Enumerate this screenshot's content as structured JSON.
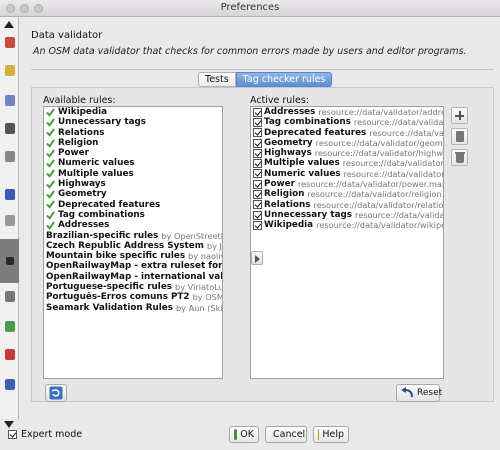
{
  "window": {
    "title": "Preferences"
  },
  "page": {
    "title": "Data validator",
    "description": "An OSM data validator that checks for common errors made by users and editor programs."
  },
  "tabs": [
    {
      "label": "Tests",
      "selected": false
    },
    {
      "label": "Tag checker rules",
      "selected": true
    }
  ],
  "available": {
    "label": "Available rules:",
    "items": [
      {
        "name": "Wikipedia",
        "by": "",
        "checked": true
      },
      {
        "name": "Unnecessary tags",
        "by": "",
        "checked": true
      },
      {
        "name": "Relations",
        "by": "",
        "checked": true
      },
      {
        "name": "Religion",
        "by": "",
        "checked": true
      },
      {
        "name": "Power",
        "by": "",
        "checked": true
      },
      {
        "name": "Numeric values",
        "by": "",
        "checked": true
      },
      {
        "name": "Multiple values",
        "by": "",
        "checked": true
      },
      {
        "name": "Highways",
        "by": "",
        "checked": true
      },
      {
        "name": "Geometry",
        "by": "",
        "checked": true
      },
      {
        "name": "Deprecated features",
        "by": "",
        "checked": true
      },
      {
        "name": "Tag combinations",
        "by": "",
        "checked": true
      },
      {
        "name": "Addresses",
        "by": "",
        "checked": true
      },
      {
        "name": "Brazilian-specific rules",
        "by": "by OpenStreetMap Bra",
        "checked": false
      },
      {
        "name": "Czech Republic Address System",
        "by": "by Jose Riha",
        "checked": false
      },
      {
        "name": "Mountain bike specific rules",
        "by": "by naoliv, Stefan",
        "checked": false
      },
      {
        "name": "OpenRailwayMap - extra ruleset for Germany",
        "by": "",
        "checked": false
      },
      {
        "name": "OpenRailwayMap - international validation r",
        "by": "",
        "checked": false
      },
      {
        "name": "Portuguese-specific rules",
        "by": "by ViriatoLusitano",
        "checked": false
      },
      {
        "name": "Português-Erros comuns PT2",
        "by": "by OSM Portuga",
        "checked": false
      },
      {
        "name": "Seamark Validation Rules",
        "by": "by Aun (Skippern) J",
        "checked": false
      }
    ]
  },
  "active": {
    "label": "Active rules:",
    "items": [
      {
        "name": "Addresses",
        "src": "resource://data/validator/addresses"
      },
      {
        "name": "Tag combinations",
        "src": "resource://data/validator/co"
      },
      {
        "name": "Deprecated features",
        "src": "resource://data/validator/"
      },
      {
        "name": "Geometry",
        "src": "resource://data/validator/geometry.m"
      },
      {
        "name": "Highways",
        "src": "resource://data/validator/highway.ma"
      },
      {
        "name": "Multiple values",
        "src": "resource://data/validator/multi"
      },
      {
        "name": "Numeric values",
        "src": "resource://data/validator/numer"
      },
      {
        "name": "Power",
        "src": "resource://data/validator/power.mapcss"
      },
      {
        "name": "Religion",
        "src": "resource://data/validator/religion.map"
      },
      {
        "name": "Relations",
        "src": "resource://data/validator/relation.ma"
      },
      {
        "name": "Unnecessary tags",
        "src": "resource://data/validator/un"
      },
      {
        "name": "Wikipedia",
        "src": "resource://data/validator/wikipedia.r"
      }
    ]
  },
  "buttons": {
    "reset": "Reset",
    "ok": "OK",
    "cancel": "Cancel",
    "help": "Help"
  },
  "footer": {
    "expert_mode": "Expert mode",
    "expert_checked": true
  },
  "colors": {
    "check_green": "#3fa32f",
    "tab_selected": "#6f9bd6"
  }
}
